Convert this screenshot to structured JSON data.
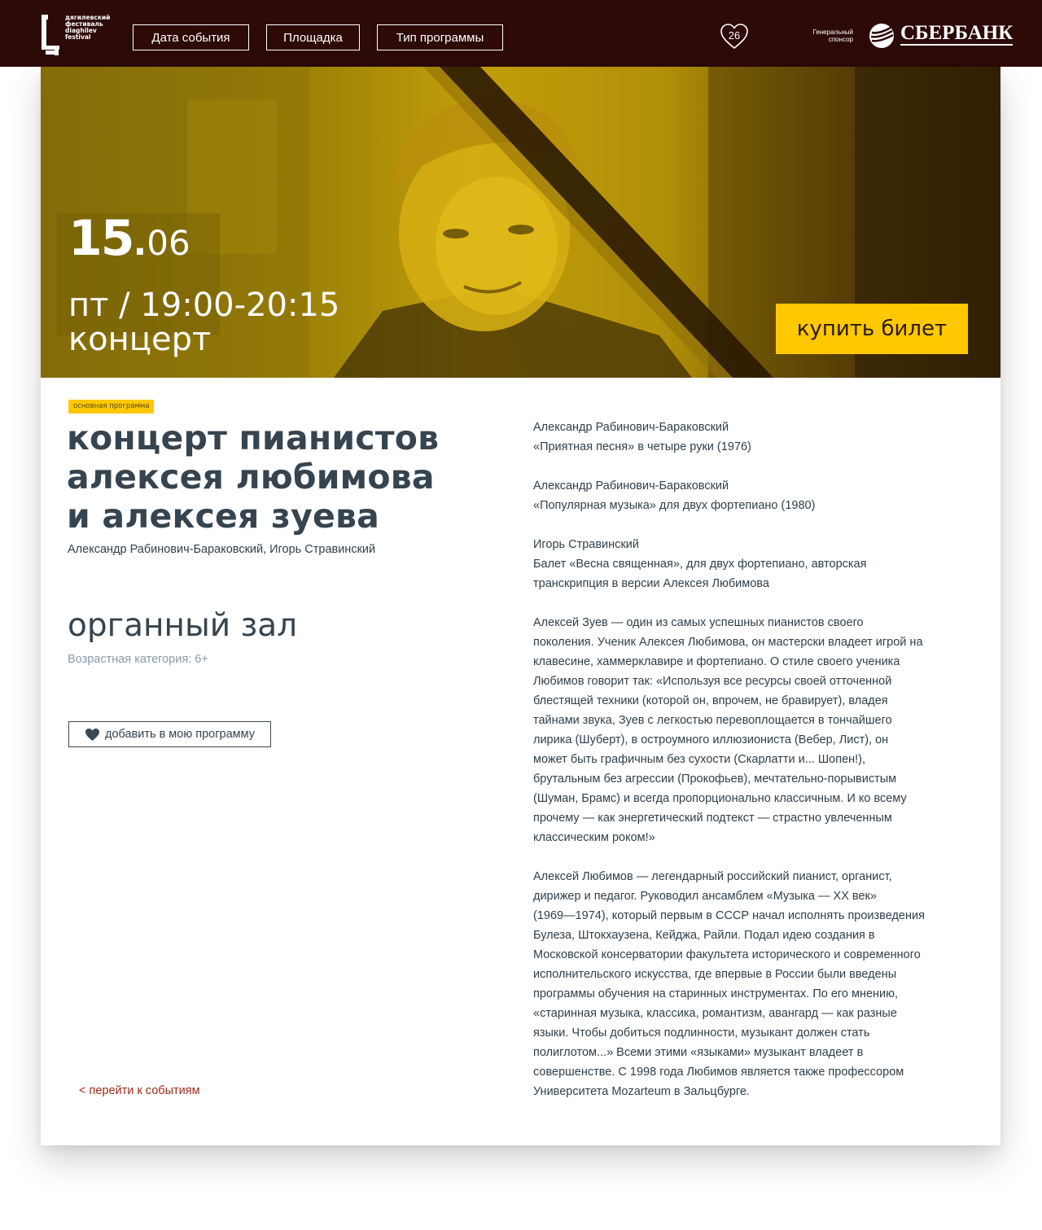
{
  "header": {
    "logo_lines": [
      "дягилевский",
      "фестиваль",
      "diaghilev",
      "festival"
    ],
    "nav": [
      "Дата события",
      "Площадка",
      "Тип программы"
    ],
    "favorites_count": "26",
    "sponsor_label_lines": [
      "Генеральный",
      "спонсор"
    ],
    "sponsor_name": "СБЕРБАНК"
  },
  "hero": {
    "day": "15",
    "dot": ".",
    "month": "06",
    "time": "пт / 19:00-20:15",
    "type": "концерт",
    "buy_label": "купить билет"
  },
  "event": {
    "tag": "основная программа",
    "title_lines": [
      "концерт пианистов",
      "алексея любимова",
      "и алексея зуева"
    ],
    "composers": "Александр Рабинович-Бараковский, Игорь Стравинский",
    "venue": "органный зал",
    "age": "Возрастная категория: 6+",
    "add_label": "добавить в мою программу",
    "back_label": "< перейти к событиям"
  },
  "program": [
    {
      "lines": [
        "Александр Рабинович-Бараковский",
        "«Приятная песня» в четыре руки (1976)"
      ]
    },
    {
      "lines": [
        "Александр Рабинович-Бараковский",
        "«Популярная музыка» для двух фортепиано (1980)"
      ]
    },
    {
      "lines": [
        "Игорь Стравинский",
        "Балет «Весна священная», для двух фортепиано, авторская",
        "транскрипция в версии Алексея Любимова"
      ]
    },
    {
      "lines": [
        "Алексей Зуев — один из самых успешных пианистов своего",
        "поколения. Ученик Алексея Любимова, он мастерски владеет игрой на",
        "клавесине, хаммерклавире и фортепиано. О стиле своего ученика",
        "Любимов говорит так: «Используя все ресурсы своей отточенной",
        "блестящей техники (которой он, впрочем, не бравирует), владея",
        "тайнами звука, Зуев с легкостью перевоплощается в тончайшего",
        "лирика (Шуберт), в остроумного иллюзиониста (Вебер, Лист), он",
        "может быть графичным без сухости (Скарлатти и... Шопен!),",
        "брутальным без агрессии (Прокофьев), мечтательно-порывистым",
        "(Шуман, Брамс) и всегда пропорционально классичным. И ко всему",
        "прочему — как энергетический подтекст — страстно увлеченным",
        "классическим роком!»"
      ]
    },
    {
      "lines": [
        "Алексей Любимов — легендарный российский пианист, органист,",
        "дирижер и педагог. Руководил ансамблем «Музыка — XX век»",
        "(1969—1974), который первым в СССР начал исполнять произведения",
        "Булеза, Штокхаузена, Кейджа, Райли. Подал идею создания в",
        "Московской консерватории факультета исторического и современного",
        "исполнительского искусства, где впервые в России были введены",
        "программы обучения на старинных инструментах. По его мнению,",
        "«старинная музыка, классика, романтизм, авангард — как разные",
        "языки. Чтобы добиться подлинности, музыкант должен стать",
        "полиглотом...» Всеми этими «языками» музыкант владеет в",
        "совершенстве. С 1998 года Любимов является также профессором",
        "Университета Mozarteum в Зальцбурге."
      ]
    }
  ],
  "colors": {
    "header_bg": "#2d0a08",
    "accent_yellow": "#ffc800",
    "text_dark": "#35444f",
    "text_muted": "#8a9aa6",
    "link_red": "#9c2a1a"
  }
}
